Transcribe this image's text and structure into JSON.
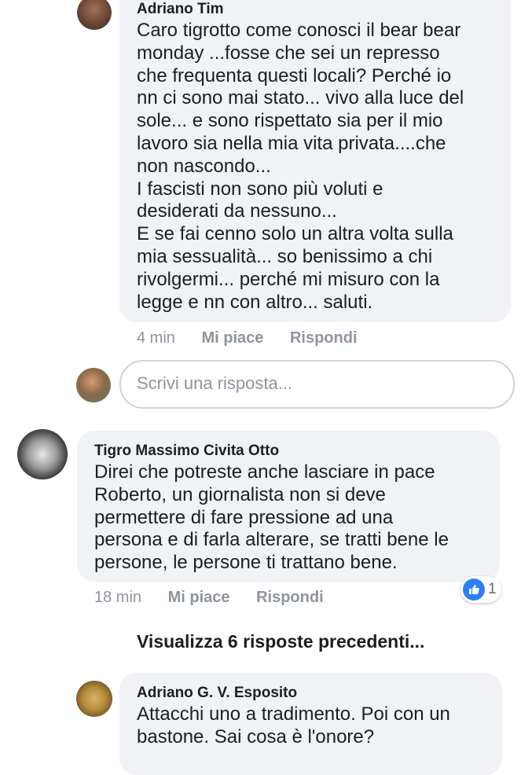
{
  "comments": [
    {
      "author": "Adriano Tim",
      "text": "Caro tigrotto come conosci il bear bear\nmonday ...fosse che sei un represso\nche frequenta questi locali? Perché io\nnn ci sono mai stato... vivo alla luce del\nsole... e sono rispettato sia per il mio\nlavoro sia nella mia vita privata....che\nnon nascondo...\nI fascisti non sono più voluti e\ndesiderati da nessuno...\nE se fai cenno solo un altra volta sulla\nmia sessualità... so benissimo a chi\nrivolgermi... perché mi misuro con la\nlegge e nn con altro... saluti.",
      "time": "4 min",
      "like_label": "Mi piace",
      "reply_label": "Rispondi"
    },
    {
      "author": "Tigro Massimo Civita Otto",
      "text": "Direi che potreste anche lasciare in pace\nRoberto, un giornalista non si deve\npermettere di fare pressione ad una\npersona e di farla alterare, se tratti bene le\npersone, le persone ti trattano bene.",
      "time": "18 min",
      "like_label": "Mi piace",
      "reply_label": "Rispondi",
      "reaction_count": "1"
    },
    {
      "author": "Adriano G. V. Esposito",
      "text": "Attacchi uno a tradimento.  Poi con un\nbastone.  Sai cosa è l'onore?"
    }
  ],
  "reply_box": {
    "placeholder": "Scrivi una risposta..."
  },
  "view_more": "Visualizza 6 risposte precedenti...",
  "colors": {
    "bubble": "#f0f2f5",
    "meta": "#8d949e",
    "like_blue": "#2d7ff9"
  }
}
